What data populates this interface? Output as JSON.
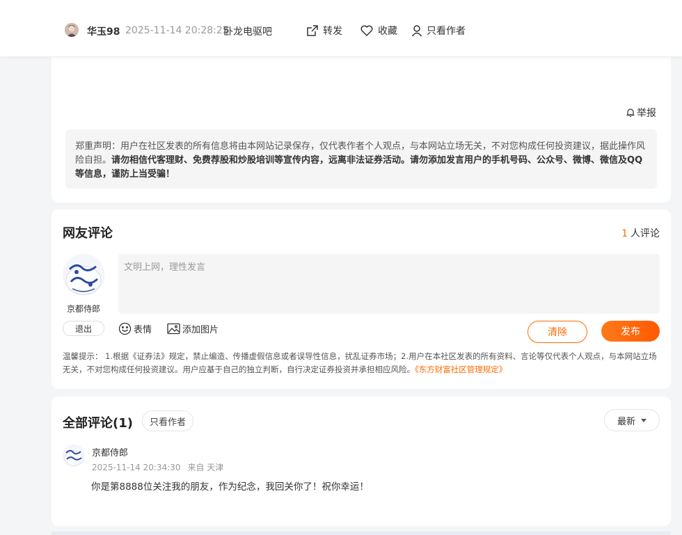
{
  "topbar": {
    "author_name": "华玉98",
    "post_time": "2025-11-14 20:28:25",
    "forum": "卧龙电驱吧",
    "forward_label": "转发",
    "favorite_label": "收藏",
    "author_only_label": "只看作者"
  },
  "post": {
    "report_label": "举报",
    "disclaimer_normal": "郑重声明：用户在社区发表的所有信息将由本网站记录保存，仅代表作者个人观点，与本网站立场无关，不对您构成任何投资建议，据此操作风险自担。",
    "disclaimer_bold": "请勿相信代客理财、免费荐股和炒股培训等宣传内容，远离非法证券活动。请勿添加发言用户的手机号码、公众号、微博、微信及QQ等信息，谨防上当受骗！"
  },
  "comment_box": {
    "title": "网友评论",
    "count": "1",
    "count_suffix": "人评论",
    "user_name": "京都侍郎",
    "placeholder": "文明上网，理性发言",
    "logout_label": "退出",
    "emoji_label": "表情",
    "image_label": "添加图片",
    "clear_label": "清除",
    "publish_label": "发布",
    "tips_text": "温馨提示： 1.根据《证券法》规定，禁止编造、传播虚假信息或者误导性信息，扰乱证券市场；2.用户在本社区发表的所有资料、言论等仅代表个人观点，与本网站立场无关，不对您构成任何投资建议。用户应基于自己的独立判断，自行决定证券投资并承担相应风险。",
    "tips_link": "《东方财富社区管理规定》"
  },
  "all_comments": {
    "title": "全部评论(1)",
    "author_only_label": "只看作者",
    "sort_label": "最新",
    "items": [
      {
        "user": "京都侍郎",
        "time": "2025-11-14 20:34:30",
        "location": "来自 天津",
        "text": "你是第8888位关注我的朋友，作为纪念，我回关你了！祝你幸运！"
      }
    ]
  },
  "colors": {
    "accent": "#ff6a00",
    "background": "#f4f5f7",
    "card": "#ffffff"
  }
}
